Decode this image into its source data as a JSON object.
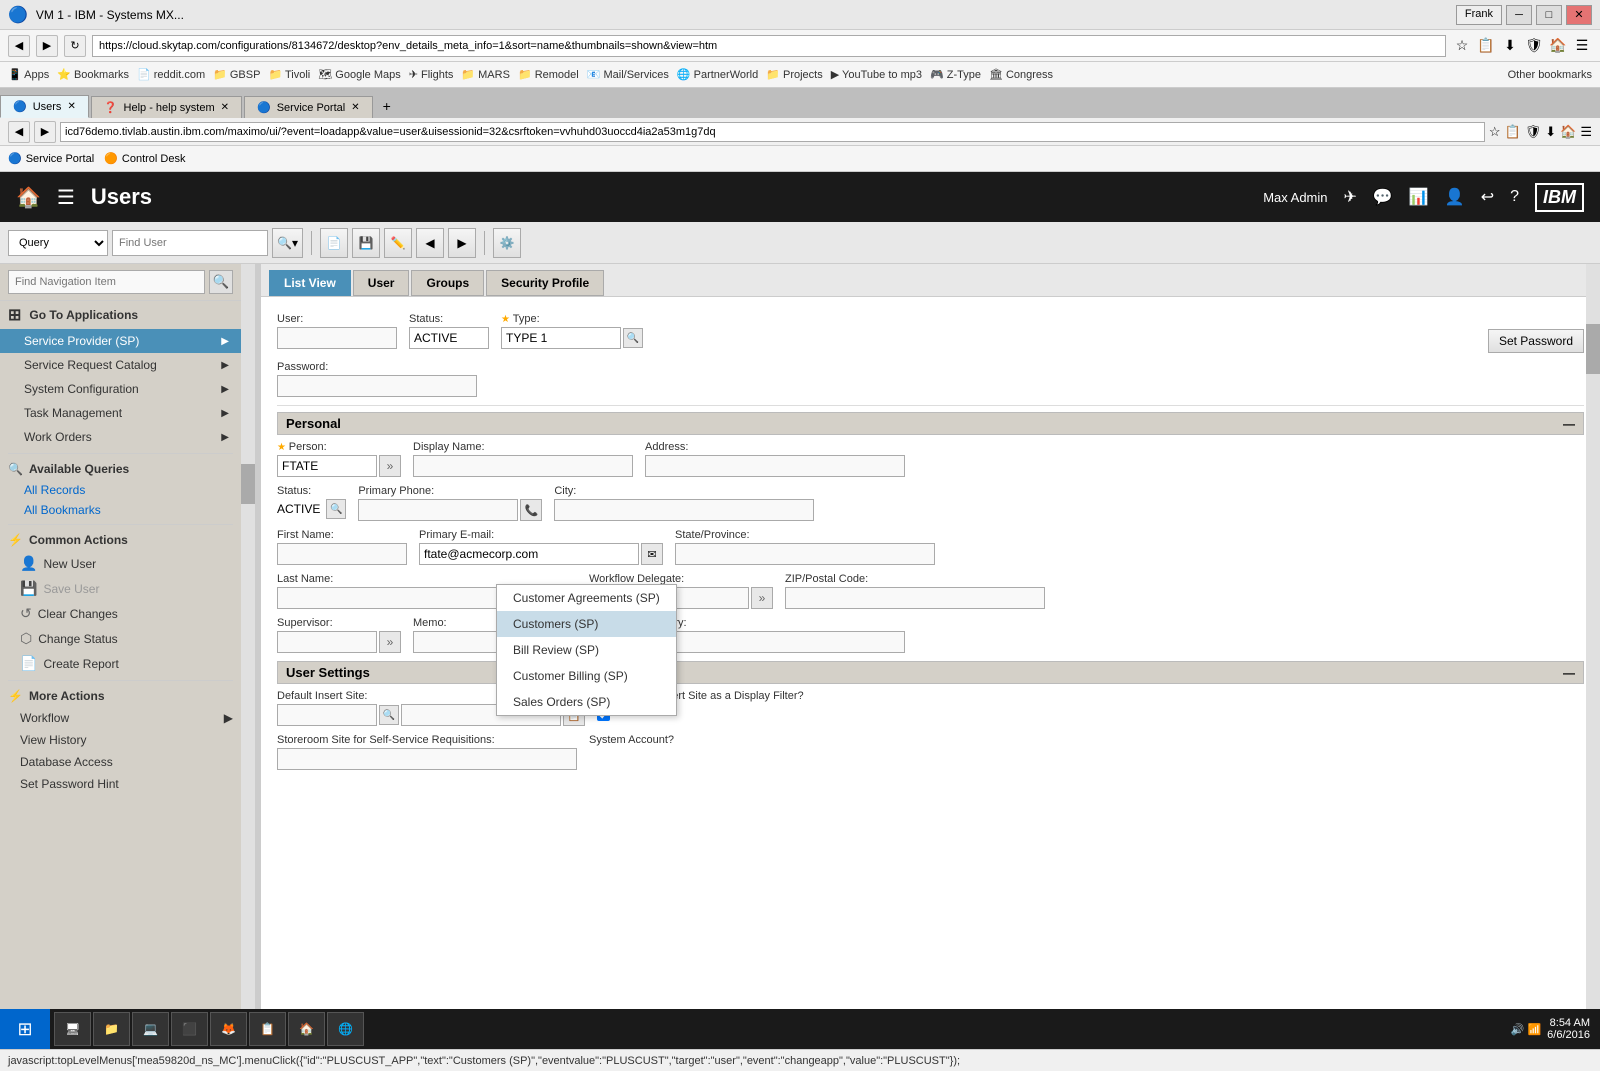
{
  "browser": {
    "title": "VM 1 - IBM - Systems MX...",
    "url": "https://cloud.skytap.com/configurations/8134672/desktop?env_details_meta_info=1&sort=name&thumbnails=shown&view=htm",
    "addr2": "icd76demo.tivlab.austin.ibm.com/maximo/ui/?event=loadapp&value=user&uisessionid=32&csrftoken=vvhuhd03uoccd4ia2a53m1g7dq",
    "tabs": [
      {
        "label": "Users",
        "active": true
      },
      {
        "label": "Help - help system",
        "active": false
      },
      {
        "label": "Service Portal",
        "active": false
      }
    ],
    "sp_bar": [
      "Service Portal",
      "Control Desk"
    ],
    "bookmarks": [
      "Apps",
      "Bookmarks",
      "reddit.com",
      "GBSP",
      "Tivoli",
      "Google Maps",
      "Flights",
      "MARS",
      "Remodel",
      "Mail/Services",
      "PartnerWorld",
      "Projects",
      "YouTube to mp3",
      "Z-Type",
      "Congress",
      "Other bookmarks"
    ]
  },
  "app_header": {
    "title": "Users",
    "user": "Max Admin",
    "ibm_label": "IBM"
  },
  "toolbar": {
    "query_placeholder": "Query",
    "find_placeholder": "Find User"
  },
  "sidebar": {
    "search_placeholder": "Find Navigation Item",
    "nav_items": [
      {
        "label": "Go To Applications",
        "type": "heading",
        "icon": "⊞"
      },
      {
        "label": "Service Provider (SP)",
        "type": "item",
        "active": true,
        "has_arrow": true
      },
      {
        "label": "Service Request Catalog",
        "type": "item",
        "has_arrow": true
      },
      {
        "label": "System Configuration",
        "type": "item",
        "has_arrow": true
      },
      {
        "label": "Task Management",
        "type": "item",
        "has_arrow": true
      },
      {
        "label": "Work Orders",
        "type": "item",
        "has_arrow": true
      }
    ],
    "available_queries": {
      "heading": "Available Queries",
      "items": [
        "All Records",
        "All Bookmarks"
      ]
    },
    "common_actions": {
      "heading": "Common Actions",
      "items": [
        {
          "label": "New User",
          "icon": "👤",
          "disabled": false
        },
        {
          "label": "Save User",
          "icon": "💾",
          "disabled": true
        },
        {
          "label": "Clear Changes",
          "icon": "↺",
          "disabled": false
        },
        {
          "label": "Change Status",
          "icon": "⬡",
          "disabled": false
        },
        {
          "label": "Create Report",
          "icon": "📄",
          "disabled": false
        }
      ]
    },
    "more_actions": {
      "heading": "More Actions",
      "items": [
        {
          "label": "Workflow",
          "has_arrow": true
        },
        {
          "label": "View History"
        },
        {
          "label": "Database Access"
        },
        {
          "label": "Set Password Hint"
        }
      ]
    }
  },
  "view_tabs": [
    "List View",
    "User",
    "Groups",
    "Security Profile"
  ],
  "active_view_tab": "List View",
  "form": {
    "user_label": "User:",
    "status_label": "Status:",
    "status_value": "ACTIVE",
    "type_label": "★ Type:",
    "type_value": "TYPE 1",
    "set_password_btn": "Set Password",
    "personal_section": "Personal",
    "person_label": "★ Person:",
    "person_value": "FTATE",
    "display_name_label": "Display Name:",
    "address_label": "Address:",
    "pers_status_label": "Status:",
    "pers_status_value": "ACTIVE",
    "primary_phone_label": "Primary Phone:",
    "city_label": "City:",
    "first_name_label": "First Name:",
    "primary_email_label": "Primary E-mail:",
    "primary_email_value": "ftate@acmecorp.com",
    "state_label": "State/Province:",
    "last_name_label": "Last Name:",
    "workflow_delegate_label": "Workflow Delegate:",
    "zip_label": "ZIP/Postal Code:",
    "supervisor_label": "Supervisor:",
    "memo_label": "Memo:",
    "country_label": "Country:",
    "user_settings_section": "User Settings",
    "default_insert_site_label": "Default Insert Site:",
    "use_default_label": "Use Default Insert Site as a Display Filter?",
    "storeroom_site_label": "Storeroom Site for Self-Service Requisitions:",
    "system_account_label": "System Account?"
  },
  "dropdown": {
    "items": [
      {
        "label": "Customer Agreements (SP)",
        "highlighted": false
      },
      {
        "label": "Customers (SP)",
        "highlighted": true
      },
      {
        "label": "Bill Review (SP)",
        "highlighted": false
      },
      {
        "label": "Customer Billing (SP)",
        "highlighted": false
      },
      {
        "label": "Sales Orders (SP)",
        "highlighted": false
      }
    ]
  },
  "status_bar": {
    "text": "javascript:topLevelMenus['mea59820d_ns_MC'].menuClick({\"id\":\"PLUSCUST_APP\",\"text\":\"Customers (SP)\",\"eventvalue\":\"PLUSCUST\",\"target\":\"user\",\"event\":\"changeapp\",\"value\":\"PLUSCUST\"});"
  },
  "taskbar": {
    "time": "8:54 AM",
    "date": "6/6/2016",
    "items": [
      "",
      "",
      "",
      "",
      "",
      "",
      "",
      ""
    ]
  }
}
